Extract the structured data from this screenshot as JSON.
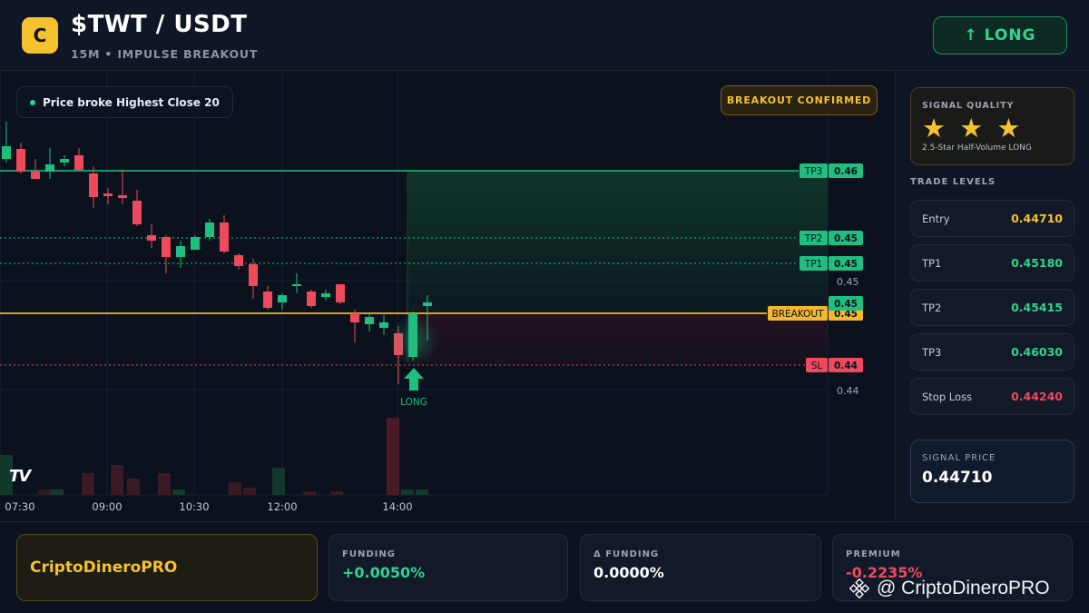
{
  "header": {
    "logo_letter": "C",
    "title": "$TWT / USDT",
    "subtitle": "15M • IMPULSE BREAKOUT",
    "direction_button": "↑ LONG"
  },
  "chart": {
    "legend_text": "Price broke Highest Close 20",
    "confirmed_badge": "BREAKOUT CONFIRMED",
    "signal_marker_label": "LONG",
    "tv_logo": "TV",
    "level_tags": [
      {
        "name": "TP3",
        "value": "0.46",
        "color": "#1fbf7f"
      },
      {
        "name": "TP2",
        "value": "0.45",
        "color": "#1fbf7f"
      },
      {
        "name": "TP1",
        "value": "0.45",
        "color": "#1fbf7f"
      },
      {
        "name": "BREAKOUT",
        "value": "0.45",
        "color": "#f3b62e"
      },
      {
        "name": "SL",
        "value": "0.44",
        "color": "#ef4a5c"
      }
    ],
    "price_ticks": [
      "0.45",
      "0.44"
    ],
    "last_price_tag": "0.45",
    "time_labels": [
      "07:30",
      "09:00",
      "10:30",
      "12:00",
      "14:00"
    ],
    "colors": {
      "up": "#1fbf7f",
      "down": "#ef4a5c",
      "breakout": "#f3b62e"
    }
  },
  "sidebar": {
    "quality_label": "SIGNAL QUALITY",
    "stars": "★ ★ ★",
    "quality_desc": "2.5-Star Half-Volume LONG",
    "trade_levels_label": "TRADE LEVELS",
    "levels": [
      {
        "name": "Entry",
        "value": "0.44710",
        "color": "#f3c22e"
      },
      {
        "name": "TP1",
        "value": "0.45180",
        "color": "#2fd38f"
      },
      {
        "name": "TP2",
        "value": "0.45415",
        "color": "#2fd38f"
      },
      {
        "name": "TP3",
        "value": "0.46030",
        "color": "#2fd38f"
      },
      {
        "name": "Stop Loss",
        "value": "0.44240",
        "color": "#ef4a5c"
      }
    ],
    "signal_price_label": "SIGNAL PRICE",
    "signal_price": "0.44710"
  },
  "footer": {
    "brand": "CriptoDineroPRO",
    "funding_label": "FUNDING",
    "funding_value": "+0.0050%",
    "delta_label": "Δ FUNDING",
    "delta_value": "0.0000%",
    "premium_label": "PREMIUM",
    "premium_value": "-0.2235%",
    "watermark": "@ CriptoDineroPRO"
  }
}
